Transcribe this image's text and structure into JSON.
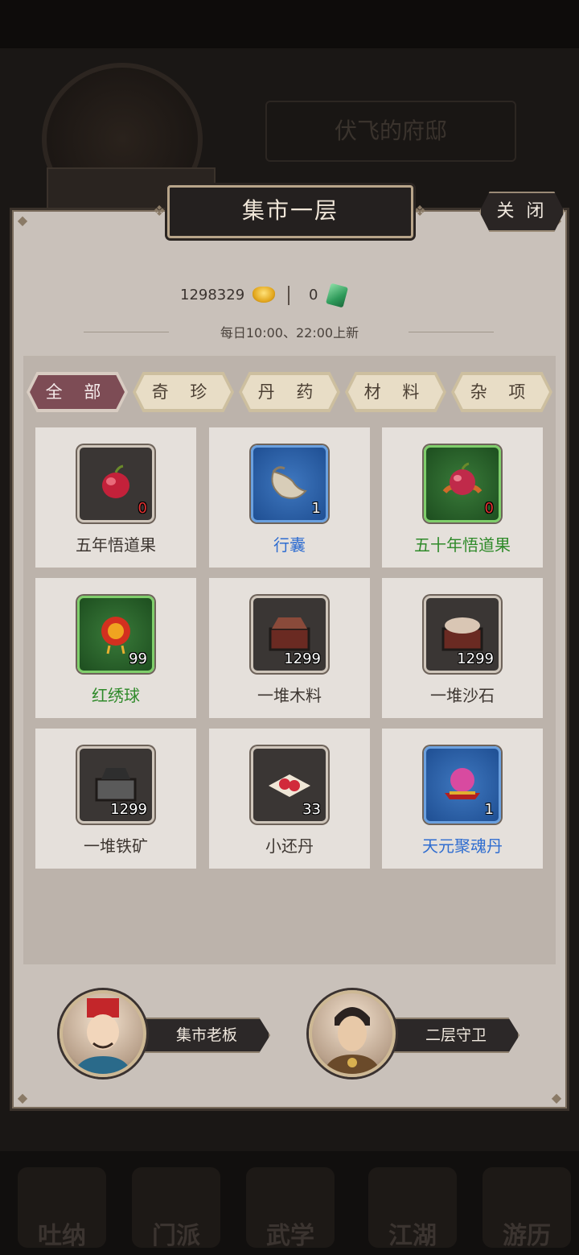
{
  "background": {
    "residence_title": "伏飞的府邸",
    "nav": [
      "吐纳",
      "门派",
      "武学",
      "江湖",
      "游历"
    ]
  },
  "panel": {
    "title": "集市一层",
    "close_label": "关 闭"
  },
  "currency": {
    "gold": "1298329",
    "jade": "0",
    "gold_icon": "gold-ingot-icon",
    "jade_icon": "jade-token-icon"
  },
  "refresh_text": "每日10:00、22:00上新",
  "tabs": [
    {
      "label": "全 部",
      "active": true
    },
    {
      "label": "奇 珍",
      "active": false
    },
    {
      "label": "丹 药",
      "active": false
    },
    {
      "label": "材 料",
      "active": false
    },
    {
      "label": "杂 项",
      "active": false
    }
  ],
  "items": [
    {
      "name": "五年悟道果",
      "count": "0",
      "rarity": "gray",
      "icon": "red-fruit-icon"
    },
    {
      "name": "行囊",
      "count": "1",
      "rarity": "blue",
      "icon": "cloth-bag-icon"
    },
    {
      "name": "五十年悟道果",
      "count": "0",
      "rarity": "green",
      "icon": "red-fruit-icon"
    },
    {
      "name": "红绣球",
      "count": "99",
      "rarity": "green",
      "icon": "embroidered-ball-icon"
    },
    {
      "name": "一堆木料",
      "count": "1299",
      "rarity": "gray",
      "icon": "wood-chest-icon"
    },
    {
      "name": "一堆沙石",
      "count": "1299",
      "rarity": "gray",
      "icon": "sand-chest-icon"
    },
    {
      "name": "一堆铁矿",
      "count": "1299",
      "rarity": "gray",
      "icon": "iron-chest-icon"
    },
    {
      "name": "小还丹",
      "count": "33",
      "rarity": "gray",
      "icon": "pill-plate-icon"
    },
    {
      "name": "天元聚魂丹",
      "count": "1",
      "rarity": "blue",
      "icon": "soul-orb-icon"
    }
  ],
  "npcs": [
    {
      "label": "集市老板"
    },
    {
      "label": "二层守卫"
    }
  ]
}
